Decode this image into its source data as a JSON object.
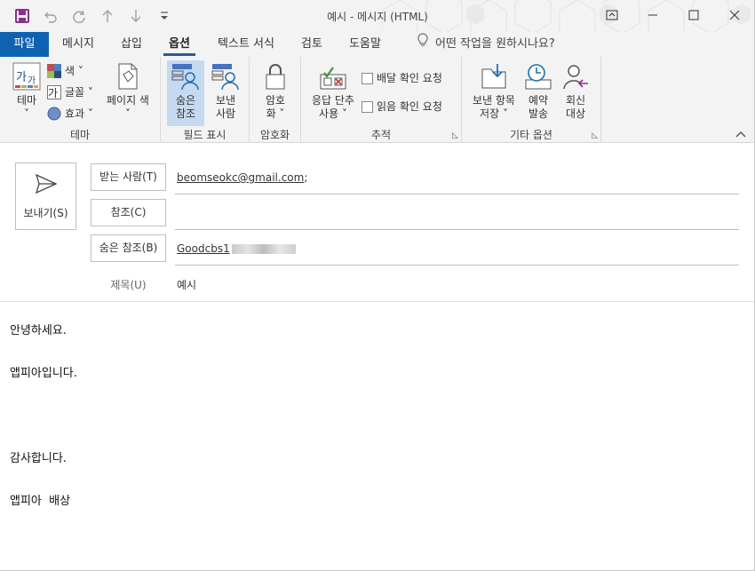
{
  "window": {
    "title": "예시  -  메시지 (HTML)"
  },
  "qat": {
    "save_icon": "save-icon",
    "undo_icon": "undo-icon",
    "redo_icon": "redo-icon",
    "up_icon": "up-arrow-icon",
    "down_icon": "down-arrow-icon",
    "customize_icon": "customize-qat-icon"
  },
  "menu": {
    "tabs": [
      {
        "label": "파일"
      },
      {
        "label": "메시지"
      },
      {
        "label": "삽입"
      },
      {
        "label": "옵션"
      },
      {
        "label": "텍스트 서식"
      },
      {
        "label": "검토"
      },
      {
        "label": "도움말"
      }
    ],
    "active_tab": "옵션",
    "tell_me": "어떤 작업을 원하시나요?"
  },
  "ribbon": {
    "theme_group": {
      "label": "테마",
      "theme_button_l1": "테마",
      "theme_button_l2": "˅",
      "color": "색 ˅",
      "font": "글꼴 ˅",
      "effect": "효과 ˅",
      "page_color_l1": "페이지 색",
      "page_color_l2": "˅"
    },
    "show_fields_group": {
      "label": "필드 표시",
      "bcc_l1": "숨은",
      "bcc_l2": "참조",
      "from_l1": "보낸",
      "from_l2": "사람"
    },
    "encrypt_group": {
      "label": "암호화",
      "encrypt_l1": "암호",
      "encrypt_l2": "화 ˅"
    },
    "tracking_group": {
      "label": "추적",
      "voting_l1": "응답 단추",
      "voting_l2": "사용 ˅",
      "delivery_receipt": "배달 확인 요청",
      "read_receipt": "읽음 확인 요청"
    },
    "more_options_group": {
      "label": "기타 옵션",
      "save_sent_l1": "보낸 항목",
      "save_sent_l2": "저장 ˅",
      "delay_l1": "예약",
      "delay_l2": "발송",
      "reply_l1": "회신",
      "reply_l2": "대상"
    }
  },
  "compose": {
    "send_label": "보내기(S)",
    "to_label": "받는 사람(T)",
    "to_value": "beomseokc@gmail.com",
    "to_suffix": ";",
    "cc_label": "참조(C)",
    "bcc_label": "숨은 참조(B)",
    "bcc_value": "Goodcbs1",
    "subject_label": "제목(U)",
    "subject_value": "예시"
  },
  "body": {
    "lines": [
      "안녕하세요.",
      "앱피아입니다.",
      "감사합니다.",
      "앱피아  배상"
    ]
  },
  "colors": {
    "accent": "#2b579a",
    "file_tab": "#0f62b0",
    "selected_button": "#c5d9f1"
  }
}
